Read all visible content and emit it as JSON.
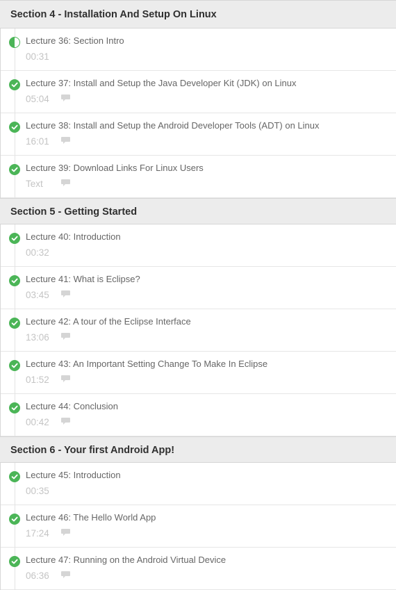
{
  "sections": [
    {
      "title": "Section 4 - Installation And Setup On Linux",
      "lectures": [
        {
          "title": "Lecture 36: Section Intro",
          "meta": "00:31",
          "status": "in-progress",
          "has_comments": false
        },
        {
          "title": "Lecture 37: Install and Setup the Java Developer Kit (JDK) on Linux",
          "meta": "05:04",
          "status": "completed",
          "has_comments": true
        },
        {
          "title": "Lecture 38: Install and Setup the Android Developer Tools (ADT) on Linux",
          "meta": "16:01",
          "status": "completed",
          "has_comments": true
        },
        {
          "title": "Lecture 39: Download Links For Linux Users",
          "meta": "Text",
          "status": "completed",
          "has_comments": true
        }
      ]
    },
    {
      "title": "Section 5 - Getting Started",
      "lectures": [
        {
          "title": "Lecture 40: Introduction",
          "meta": "00:32",
          "status": "completed",
          "has_comments": false
        },
        {
          "title": "Lecture 41: What is Eclipse?",
          "meta": "03:45",
          "status": "completed",
          "has_comments": true
        },
        {
          "title": "Lecture 42: A tour of the Eclipse Interface",
          "meta": "13:06",
          "status": "completed",
          "has_comments": true
        },
        {
          "title": "Lecture 43: An Important Setting Change To Make In Eclipse",
          "meta": "01:52",
          "status": "completed",
          "has_comments": true
        },
        {
          "title": "Lecture 44: Conclusion",
          "meta": "00:42",
          "status": "completed",
          "has_comments": true
        }
      ]
    },
    {
      "title": "Section 6 - Your first Android App!",
      "lectures": [
        {
          "title": "Lecture 45: Introduction",
          "meta": "00:35",
          "status": "completed",
          "has_comments": false
        },
        {
          "title": "Lecture 46: The Hello World App",
          "meta": "17:24",
          "status": "completed",
          "has_comments": true
        },
        {
          "title": "Lecture 47: Running on the Android Virtual Device",
          "meta": "06:36",
          "status": "completed",
          "has_comments": true
        }
      ]
    }
  ],
  "icons": {
    "completed": "check-circle-icon",
    "in_progress": "half-circle-icon",
    "comment": "comment-icon"
  },
  "colors": {
    "accent_green": "#4bb557",
    "section_bg": "#ececec",
    "title_text": "#666666",
    "meta_text": "#c4c4c4"
  }
}
